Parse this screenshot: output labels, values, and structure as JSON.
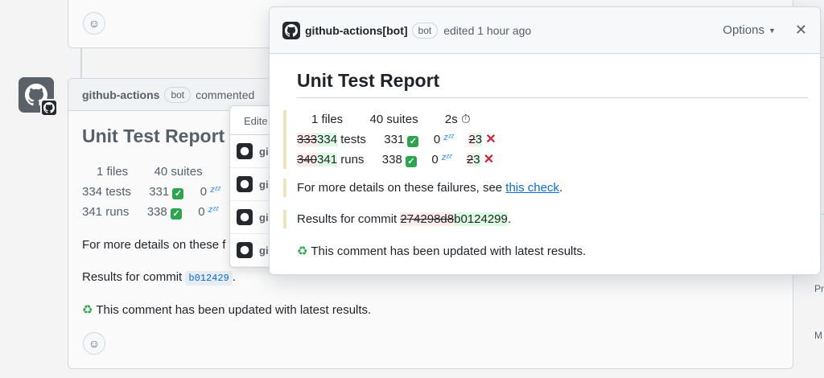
{
  "main_comment": {
    "author": "github-actions",
    "bot_label": "bot",
    "action": "commented",
    "title": "Unit Test Report",
    "summary": {
      "files": "1 files",
      "suites": "40 suites",
      "tests": "334 tests",
      "tests_passed": "331",
      "tests_skipped": "0",
      "runs": "341 runs",
      "runs_passed": "338",
      "runs_skipped": "0"
    },
    "details_prefix": "For more details on these f",
    "results_prefix": "Results for commit",
    "commit_sha": "b012429",
    "results_suffix": ".",
    "updated_note": "This comment has been updated with latest results."
  },
  "history_dropdown": {
    "header": "Edite",
    "item_text": "gi"
  },
  "modal": {
    "author": "github-actions[bot]",
    "bot_label": "bot",
    "edited": "edited 1 hour ago",
    "options_label": "Options",
    "close_symbol": "✕",
    "title": "Unit Test Report",
    "summary": {
      "files": "1 files",
      "suites": "40 suites",
      "duration": "2s",
      "tests_old": "333",
      "tests_new": "334",
      "tests_word": "tests",
      "tests_passed": "331",
      "tests_skipped": "0",
      "tests_failed_old": "2",
      "tests_failed_new": "3",
      "runs_old": "340",
      "runs_new": "341",
      "runs_word": "runs",
      "runs_passed": "338",
      "runs_skipped": "0",
      "runs_failed_old": "2",
      "runs_failed_new": "3"
    },
    "details_text": "For more details on these failures, see",
    "details_link": "this check",
    "details_end": ".",
    "results_prefix": "Results for commit",
    "commit_old": "274298d8",
    "commit_new": "b0124299",
    "results_end": ".",
    "updated_note": "This comment has been updated with latest results."
  },
  "sidebar_fragments": {
    "item1": "Pr",
    "item2": "M"
  },
  "colors": {
    "success": "#2da44e",
    "danger": "#cf222e",
    "link": "#0969da",
    "skip": "#218bff"
  }
}
